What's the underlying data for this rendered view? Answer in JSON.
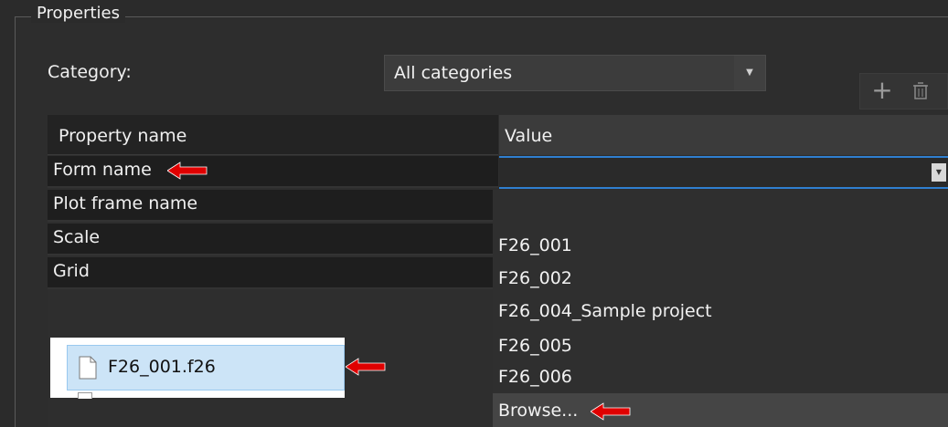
{
  "group_title": "Properties",
  "category": {
    "label": "Category:",
    "value": "All categories"
  },
  "toolbar": {
    "add_icon": "plus-icon",
    "delete_icon": "trash-icon"
  },
  "table": {
    "headers": {
      "name": "Property name",
      "value": "Value"
    },
    "rows": [
      {
        "name": "Form name"
      },
      {
        "name": "Plot frame name"
      },
      {
        "name": "Scale"
      },
      {
        "name": "Grid"
      }
    ]
  },
  "dropdown": {
    "options": [
      "F26_001",
      "F26_002",
      "F26_004_Sample project",
      "F26_005",
      "F26_006"
    ],
    "browse_label": "Browse..."
  },
  "file_explorer": {
    "selected_file": "F26_001.f26"
  },
  "colors": {
    "accent": "#2f7fd0",
    "annotation_arrow": "#e00000"
  }
}
